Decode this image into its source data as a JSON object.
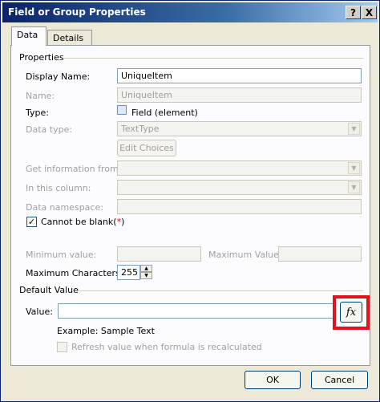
{
  "window": {
    "title": "Field or Group Properties",
    "help_button": "?",
    "close_button": "X"
  },
  "tabs": [
    {
      "label": "Data"
    },
    {
      "label": "Details"
    }
  ],
  "properties": {
    "group_label": "Properties",
    "display_name_label": "Display Name:",
    "display_name_value": "UniqueItem",
    "name_label": "Name:",
    "name_value": "UniqueItem",
    "type_label": "Type:",
    "type_value": "Field (element)",
    "data_type_label": "Data type:",
    "data_type_value": "TextType",
    "edit_choices_label": "Edit Choices",
    "get_info_label": "Get information from:",
    "in_column_label": "In this column:",
    "data_namespace_label": "Data namespace:",
    "cannot_be_blank_label": "Cannot be blank",
    "cannot_be_blank_paren_open": "(",
    "cannot_be_blank_star": "*",
    "cannot_be_blank_paren_close": ")",
    "cannot_be_blank_checked": true,
    "min_value_label": "Minimum value:",
    "max_value_label": "Maximum Value:",
    "max_chars_label": "Maximum Characters:",
    "max_chars_value": "255"
  },
  "default_value": {
    "group_label": "Default Value",
    "value_label": "Value:",
    "value": "",
    "fx_label": "fx",
    "example_text": "Example: Sample Text",
    "refresh_label": "Refresh value when formula is recalculated"
  },
  "footer": {
    "ok_label": "OK",
    "cancel_label": "Cancel"
  },
  "colors": {
    "highlight": "#e0141e",
    "title_bar": "#0a246a"
  }
}
